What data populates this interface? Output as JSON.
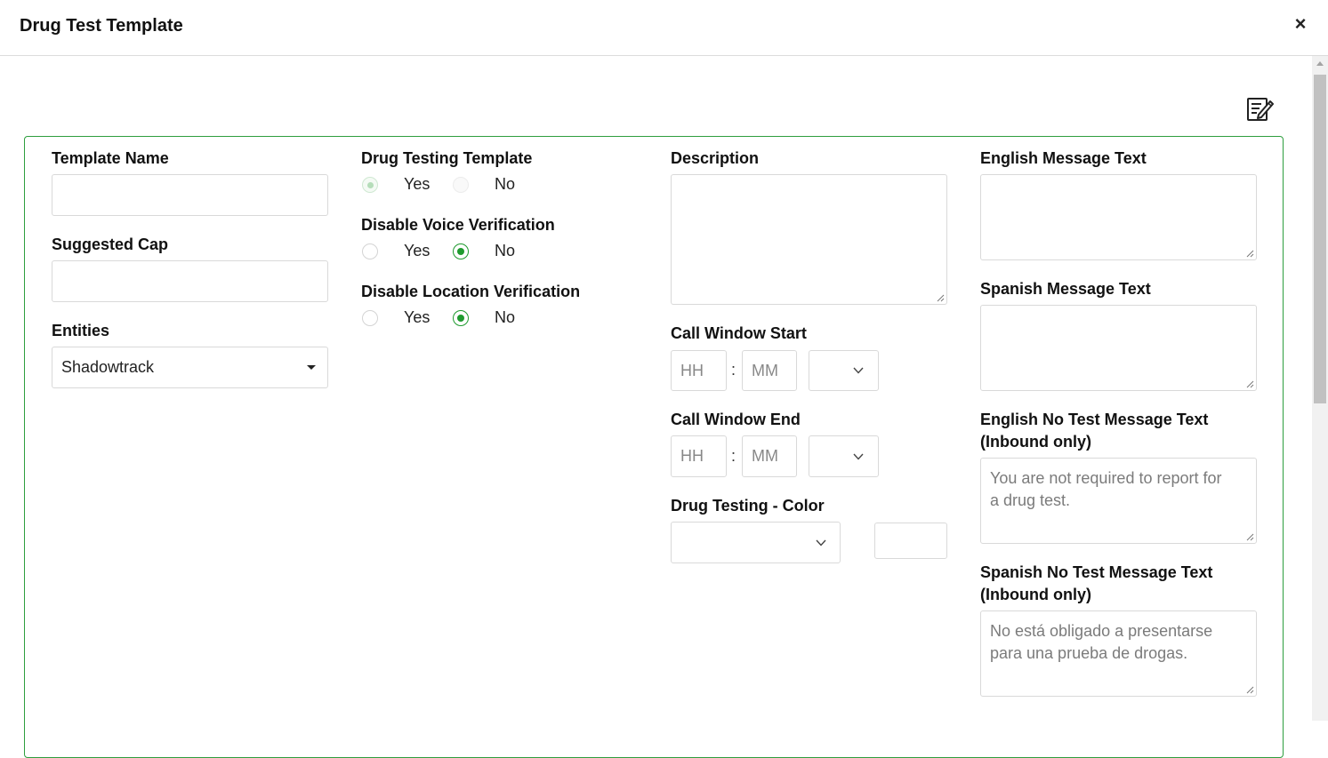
{
  "dialog": {
    "title": "Drug Test Template",
    "close_label": "×"
  },
  "form": {
    "template_name": {
      "label": "Template Name",
      "value": ""
    },
    "suggested_cap": {
      "label": "Suggested Cap",
      "value": ""
    },
    "entities": {
      "label": "Entities",
      "selected": "Shadowtrack"
    },
    "drug_testing_template": {
      "label": "Drug Testing Template",
      "yes": "Yes",
      "no": "No",
      "selected": "Yes",
      "disabled": true
    },
    "disable_voice_verification": {
      "label": "Disable Voice Verification",
      "yes": "Yes",
      "no": "No",
      "selected": "No"
    },
    "disable_location_verification": {
      "label": "Disable Location Verification",
      "yes": "Yes",
      "no": "No",
      "selected": "No"
    },
    "description": {
      "label": "Description",
      "value": ""
    },
    "call_window_start": {
      "label": "Call Window Start",
      "hh_placeholder": "HH",
      "mm_placeholder": "MM",
      "separator": ":"
    },
    "call_window_end": {
      "label": "Call Window End",
      "hh_placeholder": "HH",
      "mm_placeholder": "MM",
      "separator": ":"
    },
    "drug_testing_color": {
      "label": "Drug Testing - Color"
    },
    "english_message_text": {
      "label": "English Message Text",
      "value": ""
    },
    "spanish_message_text": {
      "label": "Spanish Message Text",
      "value": ""
    },
    "english_no_test_message": {
      "label_line1": "English No Test Message Text",
      "label_line2": "(Inbound only)",
      "line1": "You are not required to report for",
      "line2": "a drug test."
    },
    "spanish_no_test_message": {
      "label_line1": "Spanish No Test Message Text",
      "label_line2": "(Inbound only)",
      "line1": "No está obligado a presentarse",
      "line2": "para una prueba de drogas."
    }
  },
  "colors": {
    "accent": "#1e9a2e",
    "panel_border": "#2e9e3e"
  }
}
